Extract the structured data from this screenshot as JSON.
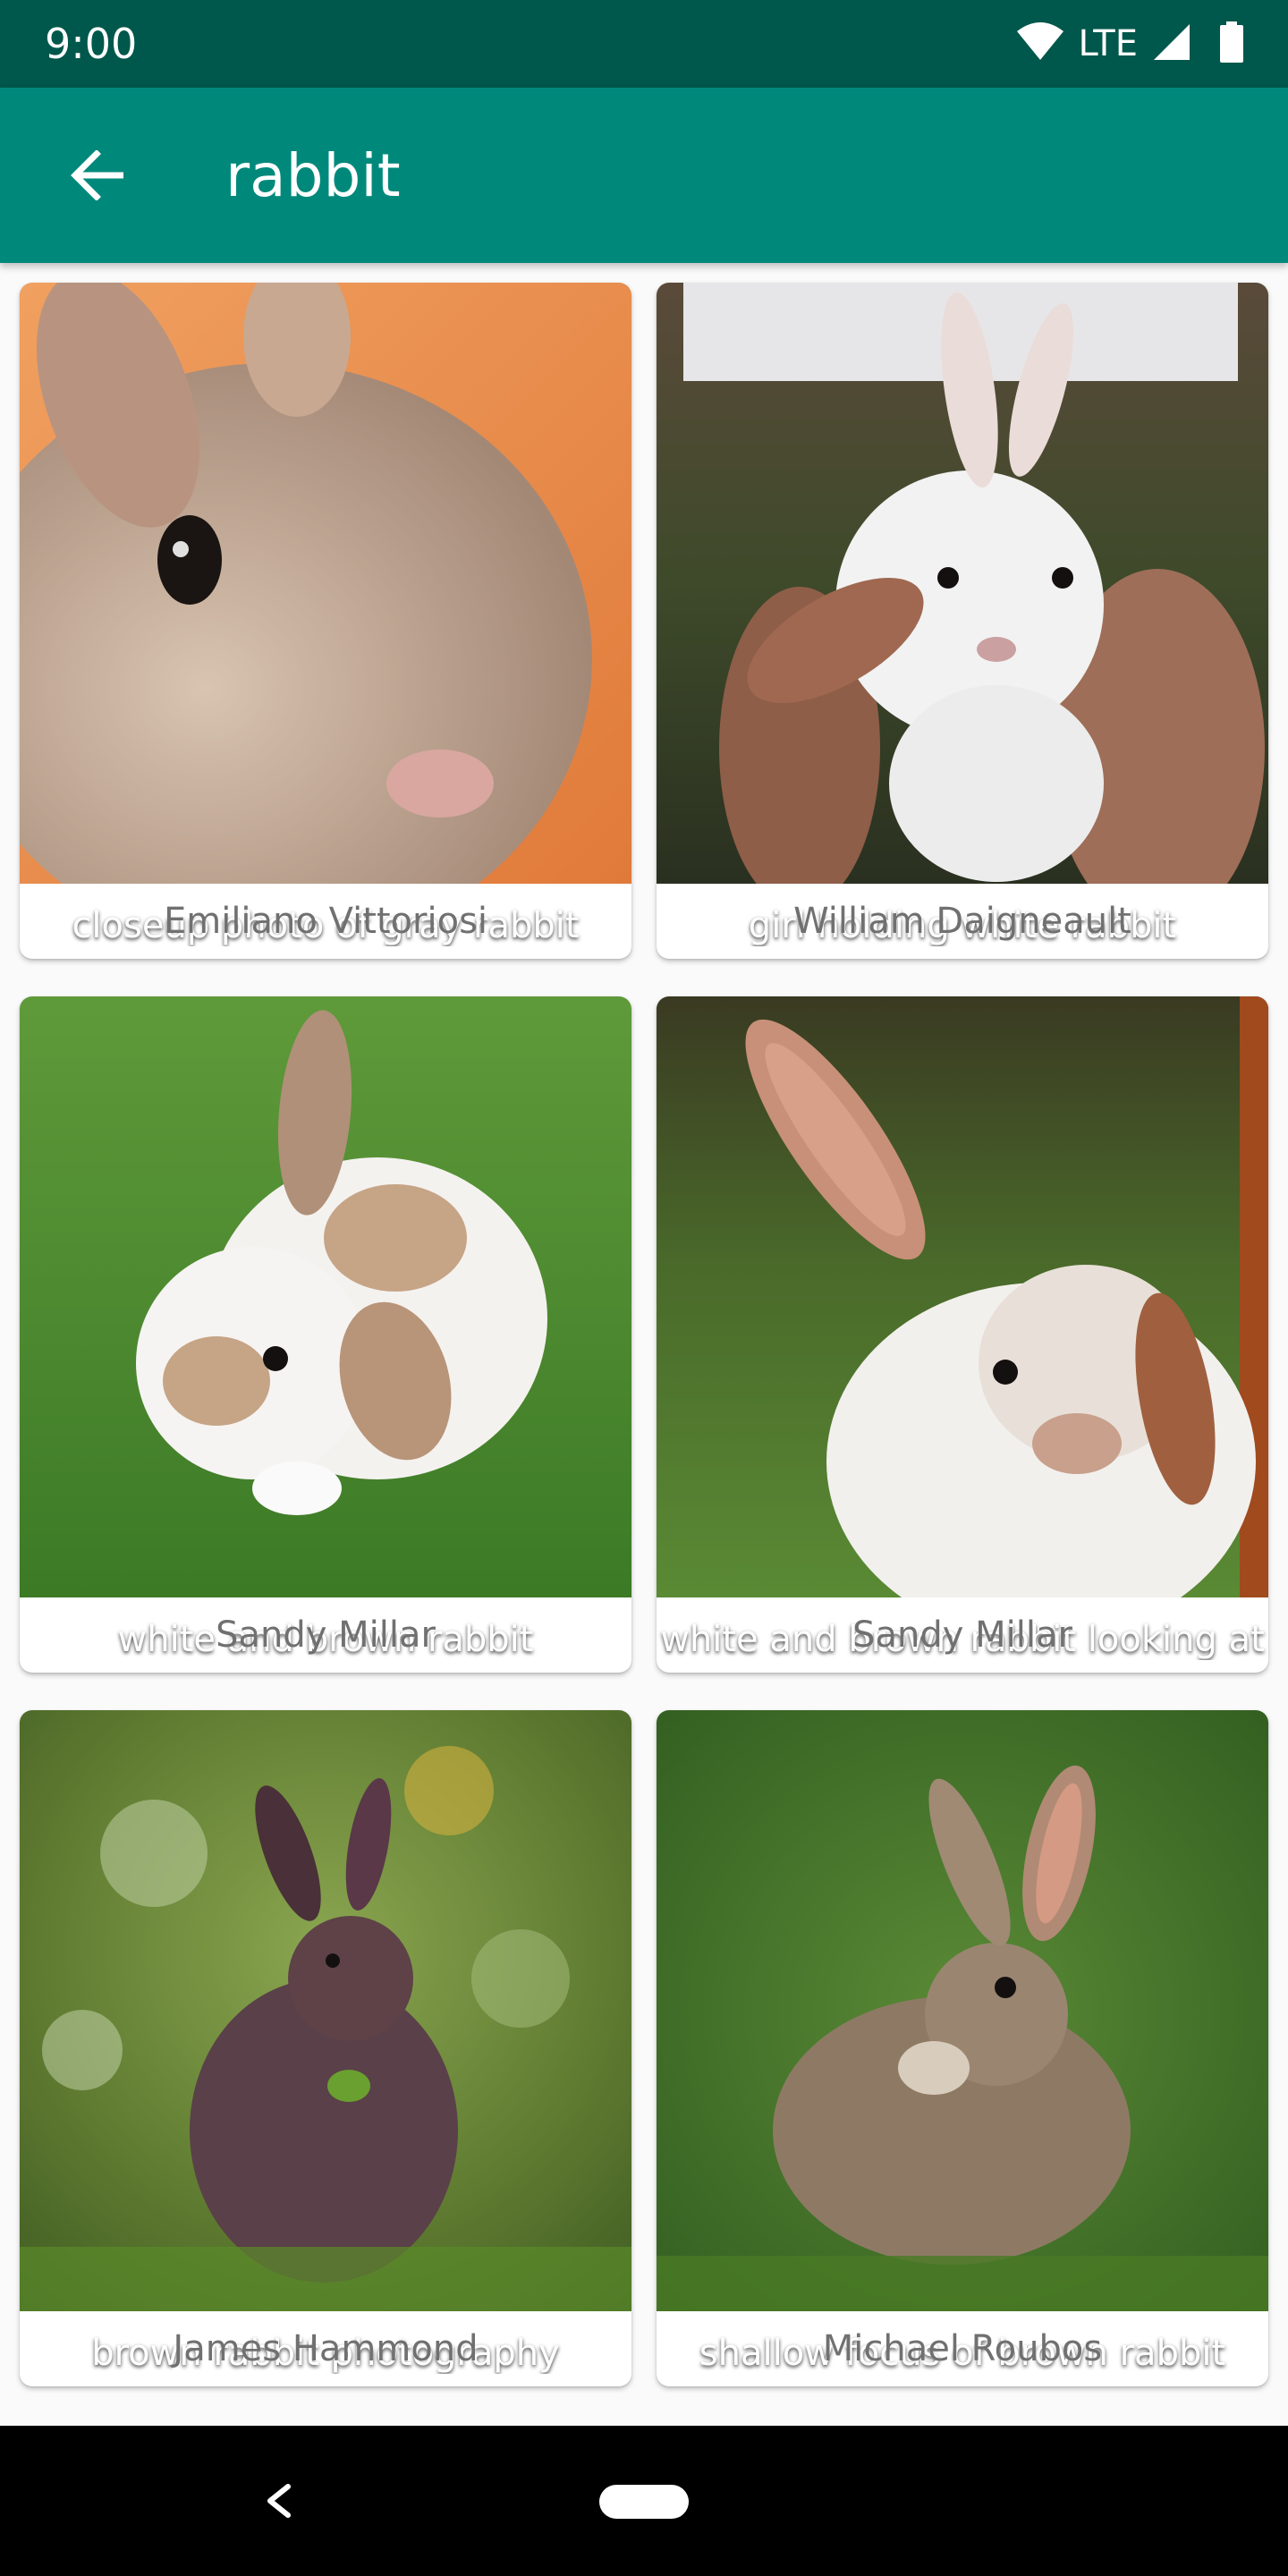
{
  "status_bar": {
    "time": "9:00",
    "network": "LTE",
    "icons": [
      "wifi-icon",
      "signal-icon",
      "battery-icon"
    ]
  },
  "app_bar": {
    "title": "rabbit",
    "back_icon": "arrow-back-icon"
  },
  "photos": [
    {
      "caption": "closeup photo of gray rabbit",
      "author": "Emiliano Vittoriosi"
    },
    {
      "caption": "girl holding white rabbit",
      "author": "William Daigneault"
    },
    {
      "caption": "white and brown rabbit",
      "author": "Sandy Millar"
    },
    {
      "caption": "white and brown rabbit looking at",
      "author": "Sandy Millar"
    },
    {
      "caption": "brown rabbit photography",
      "author": "James Hammond"
    },
    {
      "caption": "shallow focus of brown rabbit",
      "author": "Michael Roubos"
    }
  ],
  "nav_bar": {
    "icons": [
      "nav-back-icon",
      "home-pill-icon"
    ]
  },
  "colors": {
    "status_bar": "#00574b",
    "app_bar": "#00897b",
    "background": "#fafafa",
    "author_text": "#707070"
  }
}
